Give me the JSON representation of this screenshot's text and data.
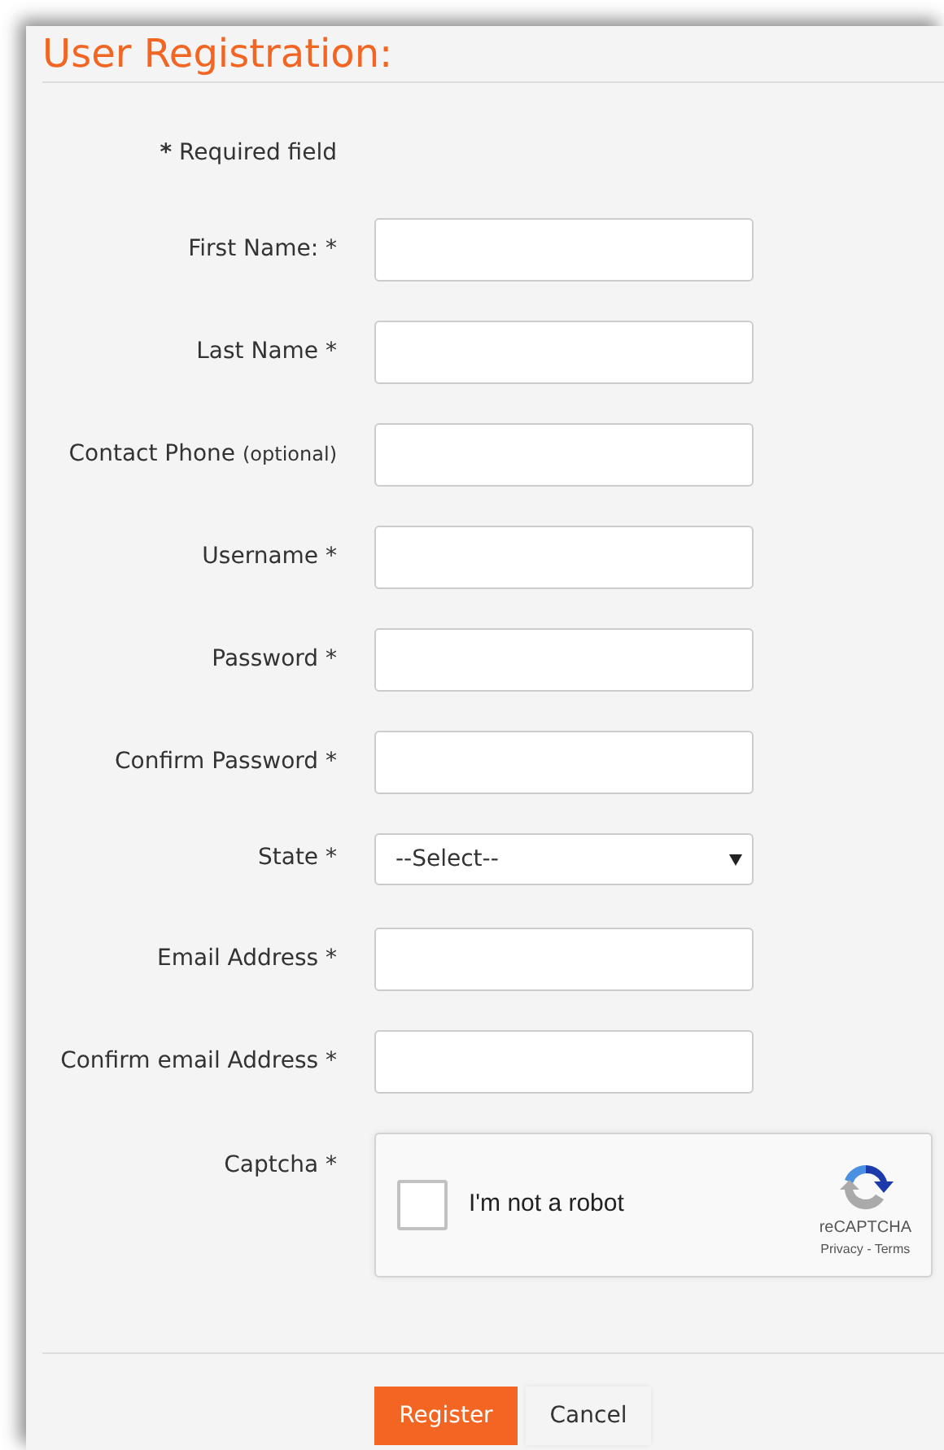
{
  "title": "User Registration:",
  "required_note": {
    "mark": "*",
    "text": "Required field"
  },
  "fields": [
    {
      "kind": "text",
      "label": "First Name: *"
    },
    {
      "kind": "text",
      "label": "Last Name *"
    },
    {
      "kind": "text",
      "label": "Contact Phone",
      "note": "(optional)"
    },
    {
      "kind": "text",
      "label": "Username *"
    },
    {
      "kind": "password",
      "label": "Password *"
    },
    {
      "kind": "password",
      "label": "Confirm Password *"
    },
    {
      "kind": "select",
      "label": "State *",
      "value": "--Select--"
    },
    {
      "kind": "text",
      "label": "Email Address *"
    },
    {
      "kind": "text",
      "label": "Confirm email Address *"
    },
    {
      "kind": "captcha",
      "label": "Captcha *",
      "checkbox_label": "I'm not a robot",
      "checked": false,
      "brand": "reCAPTCHA",
      "links": [
        "Privacy",
        "Terms"
      ],
      "link_separator": "-"
    }
  ],
  "buttons": [
    {
      "label": "Register",
      "kind": "primary"
    },
    {
      "label": "Cancel",
      "kind": "secondary"
    }
  ]
}
